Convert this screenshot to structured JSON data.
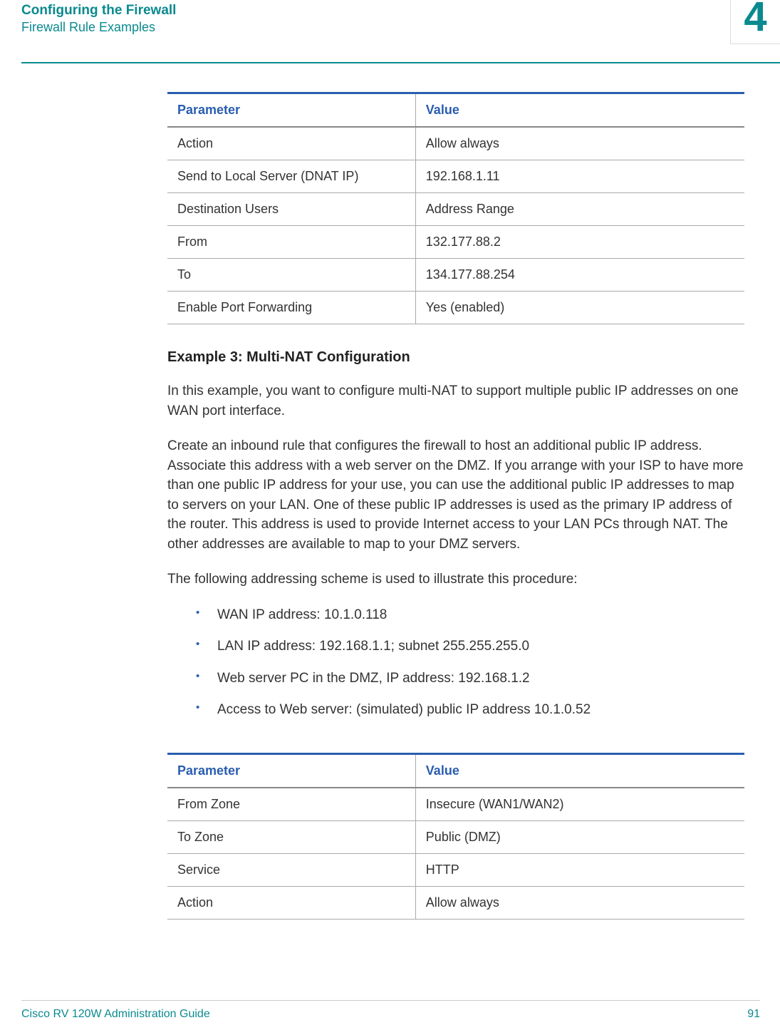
{
  "header": {
    "title": "Configuring the Firewall",
    "subtitle": "Firewall Rule Examples",
    "chapter": "4"
  },
  "table1": {
    "headers": {
      "param": "Parameter",
      "value": "Value"
    },
    "rows": [
      {
        "param": "Action",
        "value": "Allow always"
      },
      {
        "param": "Send to Local Server (DNAT IP)",
        "value": "192.168.1.11"
      },
      {
        "param": "Destination Users",
        "value": "Address Range"
      },
      {
        "param": "From",
        "value": "132.177.88.2"
      },
      {
        "param": "To",
        "value": "134.177.88.254"
      },
      {
        "param": "Enable Port Forwarding",
        "value": "Yes (enabled)"
      }
    ]
  },
  "example": {
    "heading": "Example 3: Multi-NAT Configuration",
    "p1": "In this example, you want to configure multi-NAT to support multiple public IP addresses on one WAN port interface.",
    "p2": "Create an inbound rule that configures the firewall to host an additional public IP address. Associate this address with a web server on the DMZ. If you arrange with your ISP to have more than one public IP address for your use, you can use the additional public IP addresses to map to servers on your LAN. One of these public IP addresses is used as the primary IP address of the router. This address is used to provide Internet access to your LAN PCs through NAT. The other addresses are available to map to your DMZ servers.",
    "p3": "The following addressing scheme is used to illustrate this procedure:",
    "bullets": [
      "WAN IP address: 10.1.0.118",
      " LAN IP address: 192.168.1.1; subnet 255.255.255.0",
      " Web server PC in the DMZ, IP address: 192.168.1.2",
      " Access to Web server: (simulated) public IP address 10.1.0.52"
    ]
  },
  "table2": {
    "headers": {
      "param": "Parameter",
      "value": "Value"
    },
    "rows": [
      {
        "param": "From Zone",
        "value": "Insecure (WAN1/WAN2)"
      },
      {
        "param": "To Zone",
        "value": "Public (DMZ)"
      },
      {
        "param": "Service",
        "value": "HTTP"
      },
      {
        "param": "Action",
        "value": "Allow always"
      }
    ]
  },
  "footer": {
    "left": "Cisco RV 120W Administration Guide",
    "right": "91"
  }
}
